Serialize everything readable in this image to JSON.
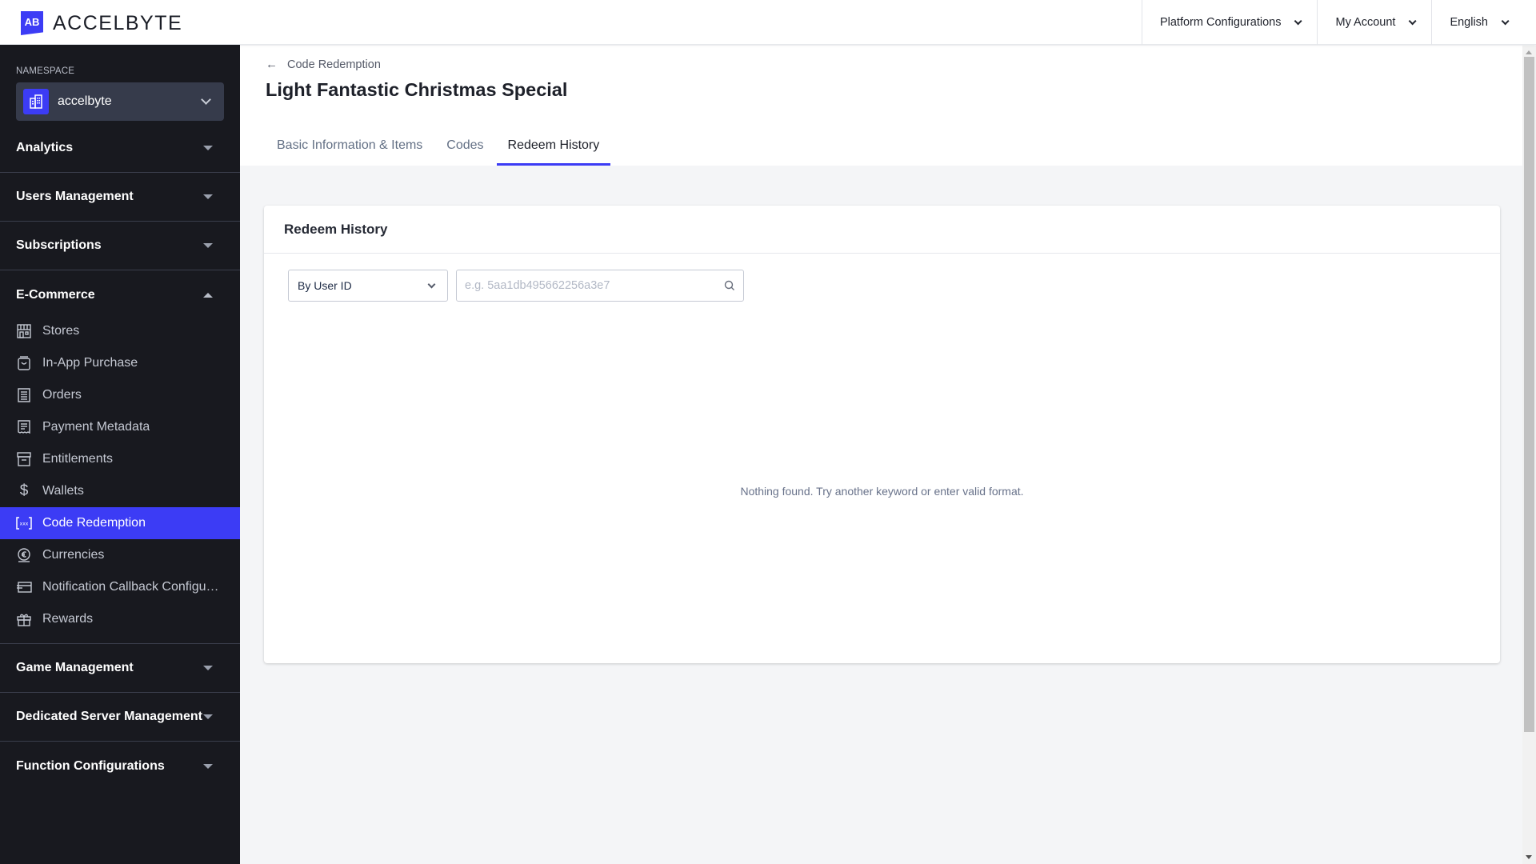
{
  "header": {
    "logo_text": "ACCELBYTE",
    "logo_mark": "AB",
    "menu": [
      {
        "label": "Platform Configurations",
        "icon": "chevron-down-icon"
      },
      {
        "label": "My Account",
        "icon": "chevron-down-icon"
      },
      {
        "label": "English",
        "icon": "chevron-down-icon"
      }
    ]
  },
  "sidebar": {
    "namespace_label": "NAMESPACE",
    "namespace_value": "accelbyte",
    "groups_top": [
      {
        "label": "Analytics",
        "expanded": false
      },
      {
        "label": "Users Management",
        "expanded": false
      },
      {
        "label": "Subscriptions",
        "expanded": false
      },
      {
        "label": "E-Commerce",
        "expanded": true
      }
    ],
    "ecommerce_items": [
      {
        "label": "Stores",
        "icon": "store-icon",
        "active": false
      },
      {
        "label": "In-App Purchase",
        "icon": "shopping-bag-icon",
        "active": false
      },
      {
        "label": "Orders",
        "icon": "receipt-icon",
        "active": false
      },
      {
        "label": "Payment Metadata",
        "icon": "document-icon",
        "active": false
      },
      {
        "label": "Entitlements",
        "icon": "archive-icon",
        "active": false
      },
      {
        "label": "Wallets",
        "icon": "dollar-icon",
        "active": false
      },
      {
        "label": "Code Redemption",
        "icon": "code-brackets-icon",
        "active": true
      },
      {
        "label": "Currencies",
        "icon": "currency-coin-icon",
        "active": false
      },
      {
        "label": "Notification Callback Configurations",
        "icon": "card-callback-icon",
        "active": false
      },
      {
        "label": "Rewards",
        "icon": "gift-icon",
        "active": false
      }
    ],
    "groups_bottom": [
      {
        "label": "Game Management",
        "expanded": false
      },
      {
        "label": "Dedicated Server Management",
        "expanded": false
      },
      {
        "label": "Function Configurations",
        "expanded": false
      }
    ]
  },
  "page": {
    "back_label": "Code Redemption",
    "title": "Light Fantastic Christmas Special",
    "tabs": [
      {
        "label": "Basic Information & Items",
        "active": false
      },
      {
        "label": "Codes",
        "active": false
      },
      {
        "label": "Redeem History",
        "active": true
      }
    ]
  },
  "card": {
    "title": "Redeem History",
    "filter_selected": "By User ID",
    "search_value": "",
    "search_placeholder": "e.g. 5aa1db495662256a3e7",
    "empty_message": "Nothing found. Try another keyword or enter valid format."
  },
  "colors": {
    "accent": "#3c3cf5",
    "sidebar_bg": "#18191f",
    "page_bg": "#f4f5f7"
  }
}
